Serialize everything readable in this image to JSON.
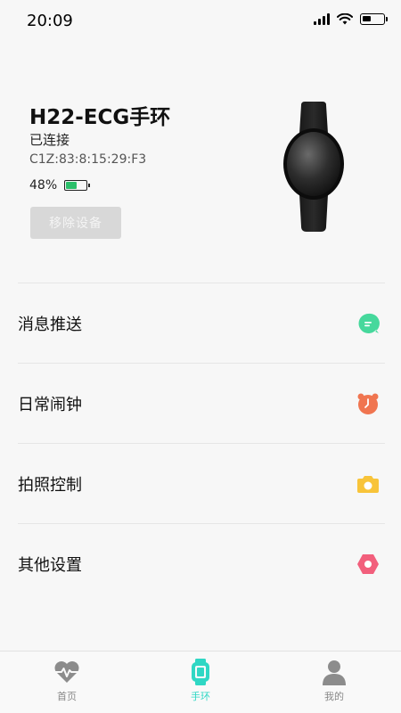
{
  "status_bar": {
    "time": "20:09"
  },
  "device": {
    "name": "H22-ECG手环",
    "status": "已连接",
    "mac": "C1Z:83:8:15:29:F3",
    "battery_percent": "48%",
    "battery_level": 0.48,
    "remove_label": "移除设备"
  },
  "menu": {
    "items": [
      {
        "label": "消息推送",
        "icon": "message-icon",
        "color": "#46d89c"
      },
      {
        "label": "日常闹钟",
        "icon": "alarm-clock-icon",
        "color": "#f07550"
      },
      {
        "label": "拍照控制",
        "icon": "camera-icon",
        "color": "#f8c43a"
      },
      {
        "label": "其他设置",
        "icon": "hexagon-settings-icon",
        "color": "#f25f7c"
      }
    ]
  },
  "tab_bar": {
    "tabs": [
      {
        "label": "首页",
        "icon": "heart-pulse-icon",
        "active": false
      },
      {
        "label": "手环",
        "icon": "watch-icon",
        "active": true
      },
      {
        "label": "我的",
        "icon": "person-icon",
        "active": false
      }
    ],
    "active_color": "#2fd7c4"
  }
}
